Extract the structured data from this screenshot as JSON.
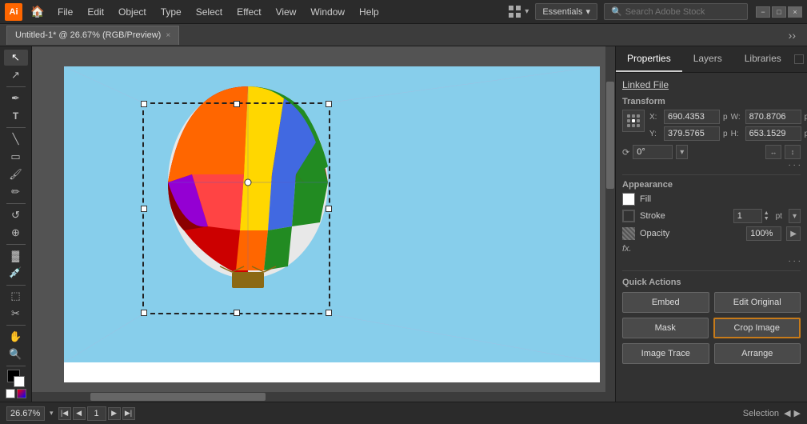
{
  "app": {
    "logo": "Ai",
    "logo_color": "#ff6600"
  },
  "menu": {
    "items": [
      "File",
      "Edit",
      "Object",
      "Type",
      "Select",
      "Effect",
      "View",
      "Window",
      "Help"
    ]
  },
  "workspace": {
    "label": "Essentials",
    "chevron": "▾"
  },
  "search": {
    "placeholder": "Search Adobe Stock",
    "icon": "🔍"
  },
  "window_controls": {
    "minimize": "−",
    "maximize": "□",
    "close": "×"
  },
  "tab": {
    "title": "Untitled-1* @ 26.67% (RGB/Preview)",
    "close": "×"
  },
  "toolbar": {
    "tools": [
      "↖",
      "↗",
      "✏",
      "✒",
      "T",
      "▭",
      "⬟",
      "✂",
      "⊕",
      "∿",
      "⊙",
      "🔧",
      "⊞",
      "⊡",
      "≋",
      "🖐",
      "🔍",
      "⊕"
    ]
  },
  "right_panel": {
    "tabs": [
      "Properties",
      "Layers",
      "Libraries"
    ],
    "active_tab": "Properties",
    "section_linked_file": "Linked File",
    "section_transform": "Transform",
    "x_label": "X:",
    "y_label": "Y:",
    "w_label": "W:",
    "h_label": "H:",
    "x_value": "690.4353",
    "y_value": "379.5765",
    "w_value": "870.8706",
    "h_value": "653.1529",
    "x_unit": "p",
    "y_unit": "p",
    "w_unit": "px",
    "h_unit": "px",
    "rotation_value": "0°",
    "section_appearance": "Appearance",
    "fill_label": "Fill",
    "stroke_label": "Stroke",
    "stroke_value": "1",
    "stroke_unit": "pt",
    "opacity_label": "Opacity",
    "opacity_value": "100%",
    "fx_label": "fx.",
    "section_quick_actions": "Quick Actions",
    "btn_embed": "Embed",
    "btn_edit_original": "Edit Original",
    "btn_mask": "Mask",
    "btn_crop_image": "Crop Image",
    "btn_image_trace": "Image Trace",
    "btn_arrange": "Arrange"
  },
  "status_bar": {
    "zoom_value": "26.67%",
    "page_number": "1",
    "label": "Selection",
    "nav_prev": "◀",
    "nav_next": "▶",
    "nav_first": "|◀",
    "nav_last": "▶|"
  },
  "canvas": {
    "artboard_bg": "white",
    "image_bg": "#87CEEB"
  }
}
